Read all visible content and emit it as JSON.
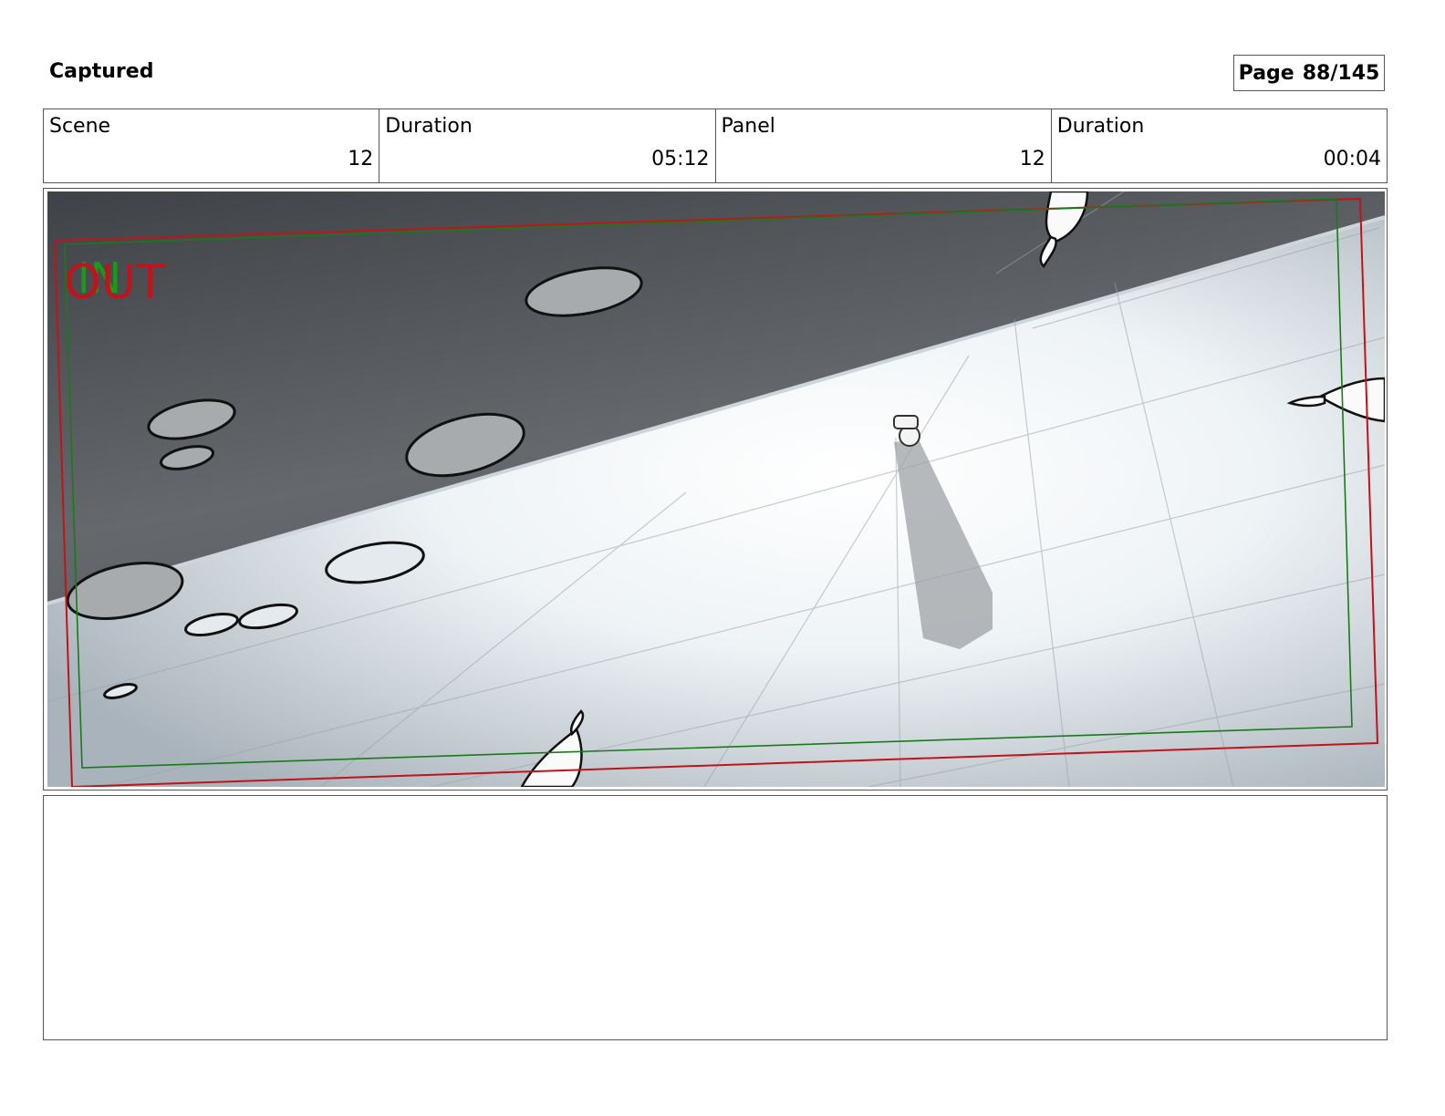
{
  "header": {
    "title": "Captured",
    "page_label": "Page",
    "page_value": "88/145"
  },
  "info": [
    {
      "label": "Scene",
      "value": "12"
    },
    {
      "label": "Duration",
      "value": "05:12"
    },
    {
      "label": "Panel",
      "value": "12"
    },
    {
      "label": "Duration",
      "value": "00:04"
    }
  ],
  "panel": {
    "overlay_in": "IN",
    "overlay_out": "OUT",
    "colors": {
      "safe_frame_red": "#c0141c",
      "safe_frame_green": "#1a7a1a",
      "wall": "#5a5d61",
      "floor": "#e8eef2"
    }
  },
  "notes": {
    "text": ""
  }
}
